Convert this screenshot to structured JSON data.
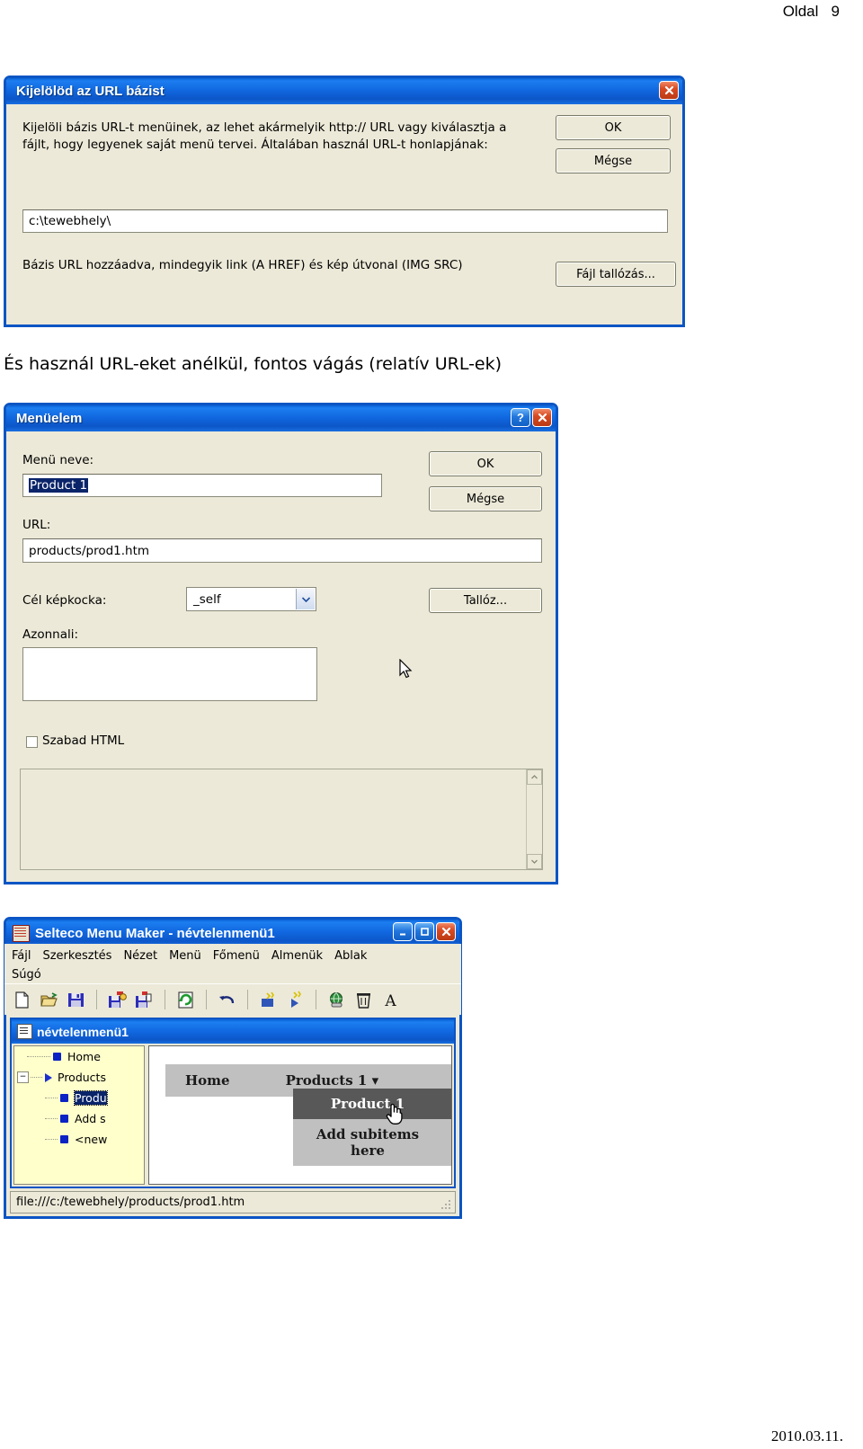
{
  "page": {
    "header_right": "Oldal   9",
    "footer_right": "2010.03.11."
  },
  "caption": "És használ URL-eket anélkül, fontos vágás (relatív URL-ek)",
  "dialog_base_url": {
    "title": "Kijelölöd az URL bázist",
    "close_label": "✕",
    "description": "Kijelöli bázis URL-t menüinek, az lehet akármelyik http:// URL vagy kiválasztja a fájlt, hogy legyenek saját menü tervei. Általában használ URL-t honlapjának:",
    "url_value": "c:\\tewebhely\\",
    "note": "Bázis URL hozzáadva, mindegyik link (A HREF) és kép útvonal (IMG SRC)",
    "ok_label": "OK",
    "cancel_label": "Mégse",
    "browse_label": "Fájl tallózás..."
  },
  "dialog_menu_item": {
    "title": "Menüelem",
    "help_label": "?",
    "close_label": "✕",
    "name_label": "Menü neve:",
    "name_value": "Product 1",
    "url_label": "URL:",
    "url_value": "products/prod1.htm",
    "target_label": "Cél képkocka:",
    "target_value": "_self",
    "tooltip_label": "Azonnali:",
    "tooltip_value": "",
    "free_html_label": "Szabad HTML",
    "free_html_checked": false,
    "free_html_value": "",
    "ok_label": "OK",
    "cancel_label": "Mégse",
    "browse_label": "Tallóz..."
  },
  "app": {
    "title": "Selteco Menu Maker - névtelenmenü1",
    "window_buttons": {
      "minimize": "_",
      "maximize": "❐",
      "close": "✕"
    },
    "menus": [
      "Fájl",
      "Szerkesztés",
      "Nézet",
      "Menü",
      "Főmenü",
      "Almenük",
      "Ablak",
      "Súgó"
    ],
    "toolbar_icons": [
      "new-document-icon",
      "open-folder-icon",
      "save-disk-icon",
      "save-publish-icon",
      "save-as-icon",
      "refresh-icon",
      "undo-icon",
      "add-item-icon",
      "add-subitem-icon",
      "publish-web-icon",
      "delete-trash-icon",
      "font-icon"
    ],
    "mdi": {
      "title": "névtelenmenü1",
      "tree": [
        {
          "label": "Home",
          "depth": 1,
          "marker": "square",
          "expander": false,
          "selected": false
        },
        {
          "label": "Products",
          "depth": 1,
          "marker": "triangle",
          "expander": true,
          "selected": false
        },
        {
          "label": "Produ",
          "depth": 2,
          "marker": "square",
          "expander": false,
          "selected": true
        },
        {
          "label": "Add s",
          "depth": 2,
          "marker": "square",
          "expander": false,
          "selected": false
        },
        {
          "label": "<new",
          "depth": 2,
          "marker": "square",
          "expander": false,
          "selected": false
        }
      ],
      "preview": {
        "bar_items": [
          "Home",
          "Products 1 ▾"
        ],
        "dropdown_items": [
          {
            "label": "Product 1",
            "highlighted": true
          },
          {
            "label": "Add subitems",
            "highlighted": false
          },
          {
            "label": "here",
            "highlighted": false
          }
        ]
      }
    },
    "status_text": "file:///c:/tewebhely/products/prod1.htm"
  },
  "colors": {
    "title_blue": "#0b55c4",
    "dialog_face": "#ece9d8",
    "tree_bg": "#ffffcc",
    "selection": "#0a246a",
    "menu_gray": "#c0c0c0",
    "menu_hl": "#585858"
  }
}
